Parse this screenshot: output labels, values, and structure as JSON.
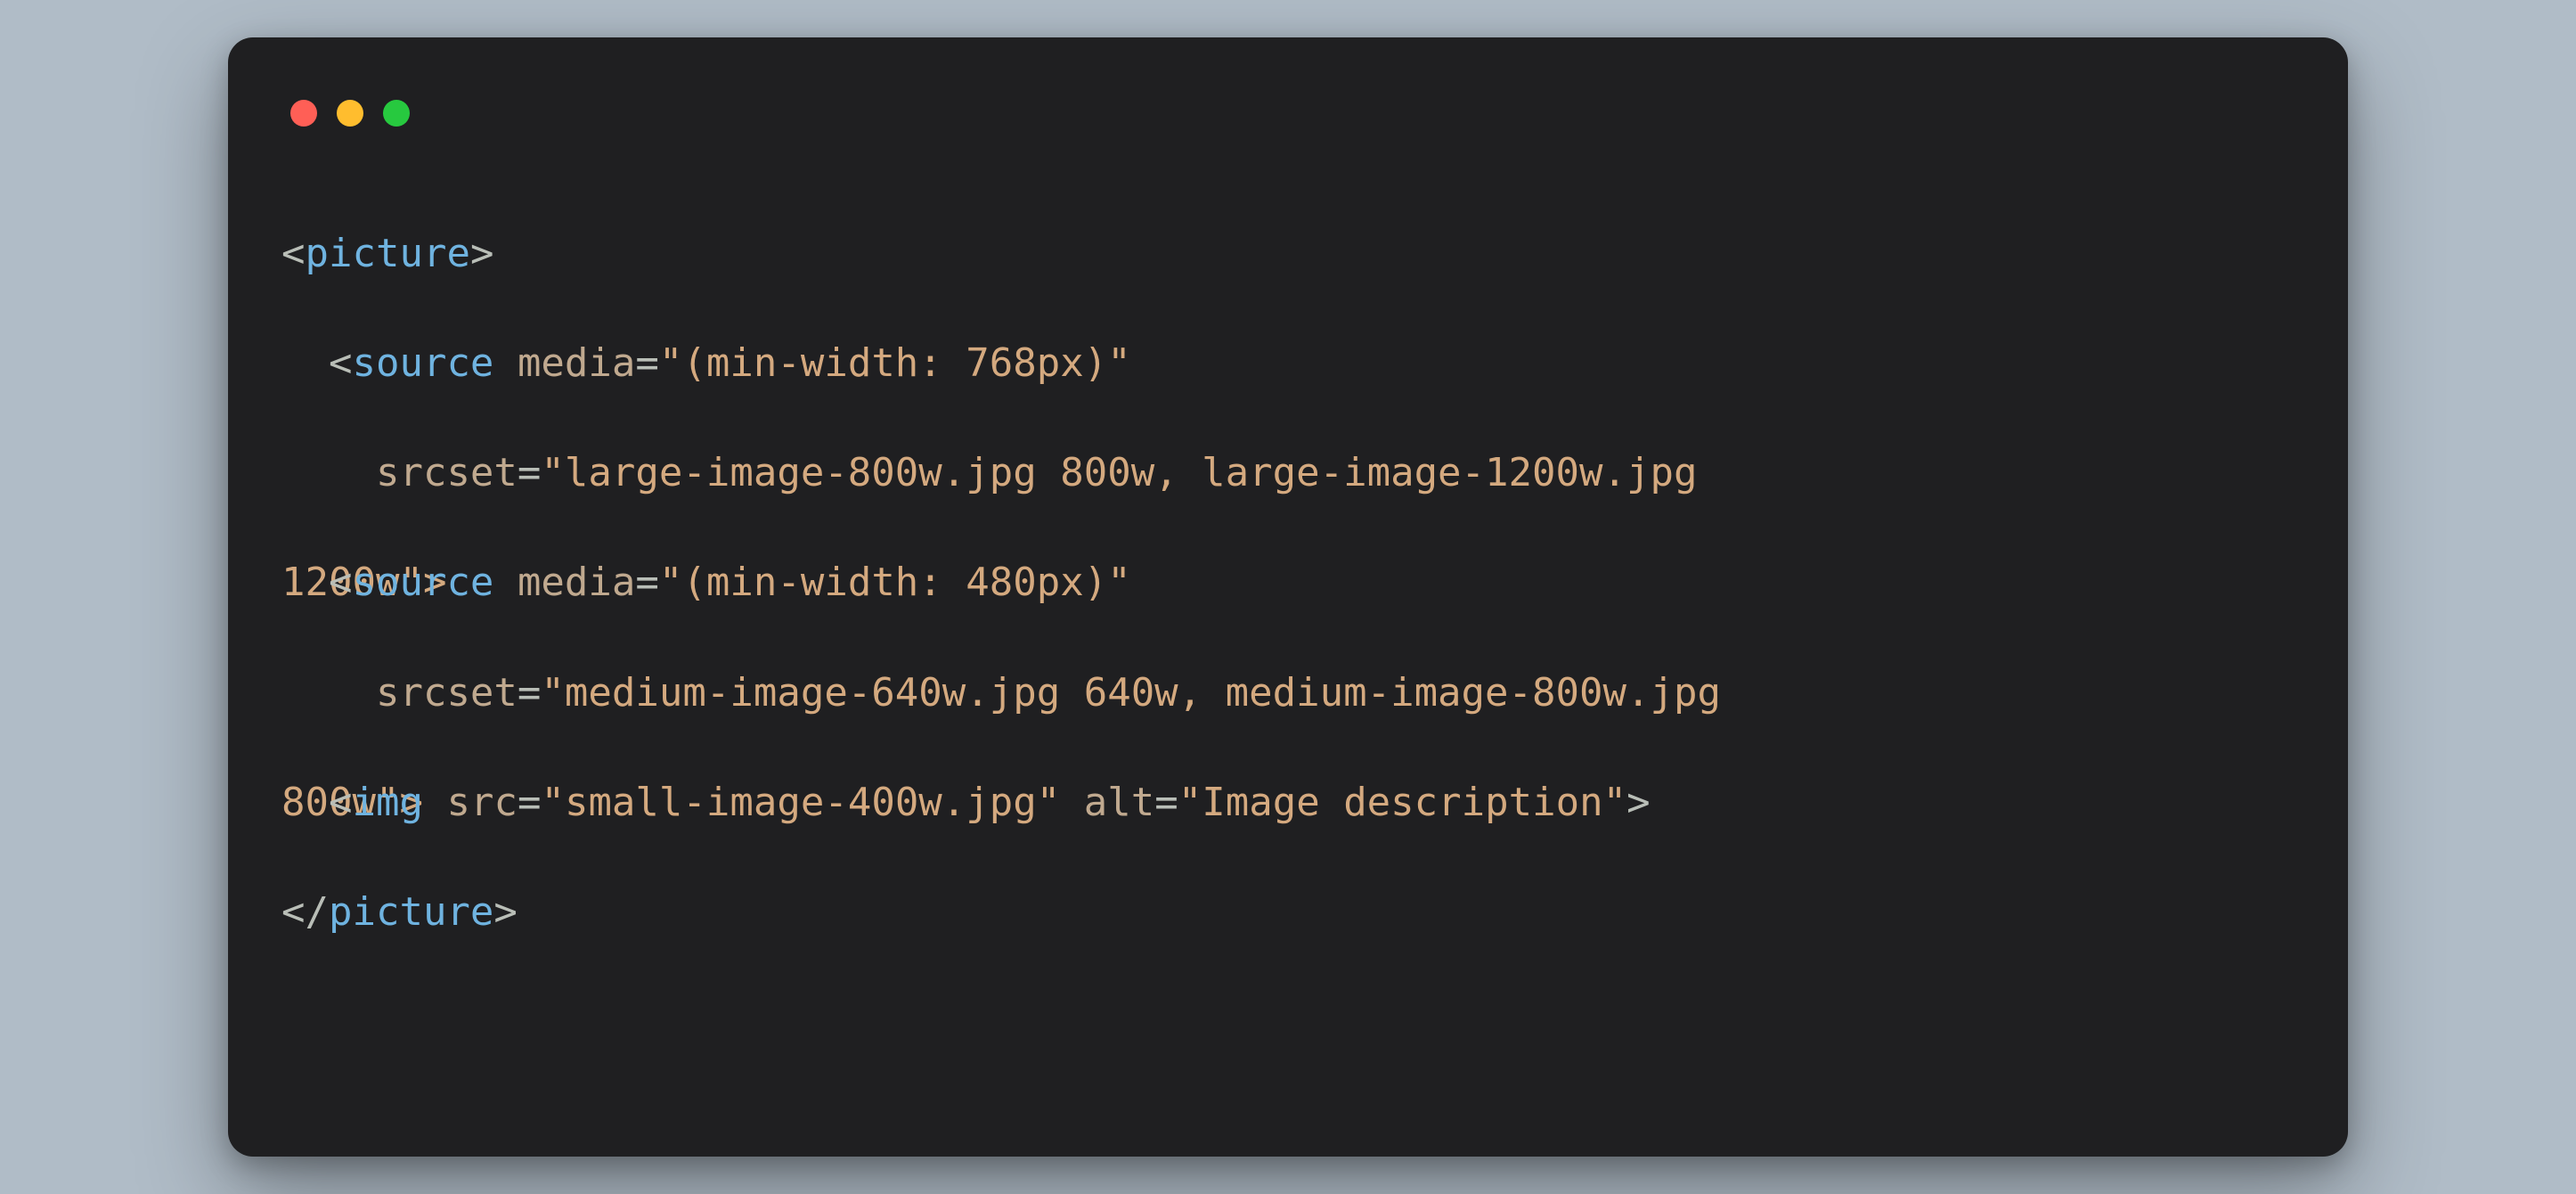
{
  "colors": {
    "bg_page": "#b0bcc7",
    "bg_window": "#1f1f21",
    "traffic_red": "#ff5f56",
    "traffic_yellow": "#ffbd2e",
    "traffic_green": "#27c93f",
    "tag_name": "#6fb3e0",
    "attr_name": "#c0a98f",
    "attr_value": "#d4a97f",
    "punct": "#b9beb7"
  },
  "code": {
    "line1": {
      "open": "<",
      "tag": "picture",
      "close": ">"
    },
    "line2": {
      "indent": "  ",
      "open": "<",
      "tag": "source",
      "sp": " ",
      "attr_media": "media",
      "eq": "=",
      "q": "\"",
      "media_val": "(min-width: 768px)"
    },
    "line3": {
      "indent": "    ",
      "attr_srcset": "srcset",
      "eq": "=",
      "q": "\"",
      "srcset_val": "large-image-800w.jpg 800w, large-image-1200w.jpg"
    },
    "line4_5": {
      "base_tail": "1200w\">",
      "over_indent": "  ",
      "over_open": "<",
      "over_tag": "source",
      "over_sp": " ",
      "over_attr_media": "media",
      "over_eq": "=",
      "over_q": "\"",
      "over_media_val": "(min-width: 480px)"
    },
    "line6": {
      "indent": "    ",
      "attr_srcset": "srcset",
      "eq": "=",
      "q": "\"",
      "srcset_val": "medium-image-640w.jpg 640w, medium-image-800w.jpg"
    },
    "line7_8": {
      "base_tail": "800w\">",
      "over_indent": "  ",
      "over_open": "<",
      "over_tag": "img",
      "over_sp": " ",
      "attr_src": "src",
      "eq": "=",
      "q": "\"",
      "src_val": "small-image-400w.jpg",
      "sp": " ",
      "attr_alt": "alt",
      "alt_val": "Image description",
      "close": ">"
    },
    "line9": {
      "open": "</",
      "tag": "picture",
      "close": ">"
    }
  }
}
